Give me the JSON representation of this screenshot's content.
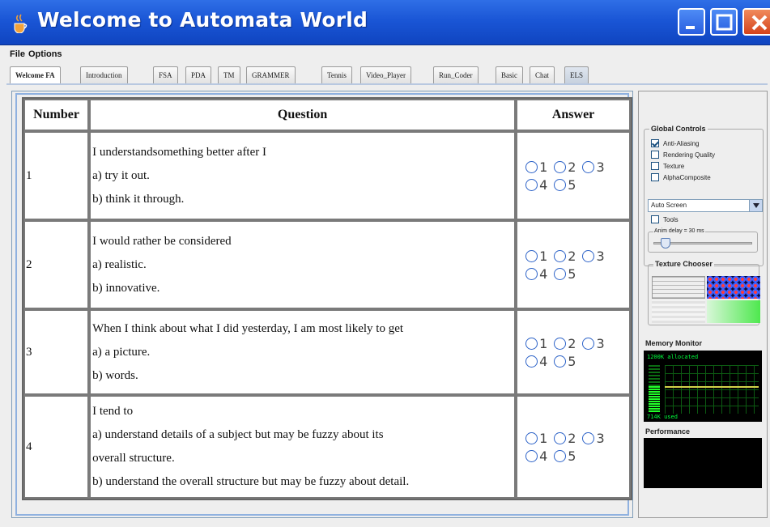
{
  "window": {
    "title": "Welcome to Automata World",
    "colors": {
      "titlebar": "#1a56d6",
      "close": "#d5431b"
    }
  },
  "menu": {
    "items": [
      "File",
      "Options"
    ]
  },
  "tabs": [
    {
      "label": "Welcome FA",
      "active": true
    },
    {
      "label": "Introduction"
    },
    {
      "label": "FSA"
    },
    {
      "label": "PDA"
    },
    {
      "label": "TM"
    },
    {
      "label": "GRAMMER"
    },
    {
      "label": "Tennis"
    },
    {
      "label": "Video_Player"
    },
    {
      "label": "Run_Coder"
    },
    {
      "label": "Basic"
    },
    {
      "label": "Chat"
    },
    {
      "label": "ELS"
    }
  ],
  "table": {
    "headers": {
      "number": "Number",
      "question": "Question",
      "answer": "Answer"
    },
    "rows": [
      {
        "number": "1",
        "lines": [
          "I understandsomething better after I",
          "a) try it out.",
          "b) think it through."
        ]
      },
      {
        "number": "2",
        "lines": [
          "I would rather be considered",
          "a) realistic.",
          "b) innovative."
        ]
      },
      {
        "number": "3",
        "lines": [
          "When I think about what I did yesterday, I am most likely to get",
          "a) a picture.",
          "b) words."
        ]
      },
      {
        "number": "4",
        "lines": [
          "I tend to",
          "a) understand details of a subject but may be fuzzy about its",
          "overall structure.",
          "b) understand the overall structure but may be fuzzy about detail."
        ]
      }
    ],
    "options": [
      "1",
      "2",
      "3",
      "4",
      "5"
    ]
  },
  "controls": {
    "global_title": "Global Controls",
    "checkboxes": [
      {
        "label": "Anti-Aliasing",
        "checked": true
      },
      {
        "label": "Rendering Quality",
        "checked": false
      },
      {
        "label": "Texture",
        "checked": false
      },
      {
        "label": "AlphaComposite",
        "checked": false
      }
    ],
    "screen_select": "Auto Screen",
    "tools_label": "Tools",
    "slider_label": "Anim delay = 30 ms",
    "slider_value": 0.08,
    "texture_title": "Texture Chooser",
    "memory_title": "Memory Monitor",
    "memory_top": "1200K allocated",
    "memory_bottom": "714K used",
    "performance_title": "Performance"
  }
}
